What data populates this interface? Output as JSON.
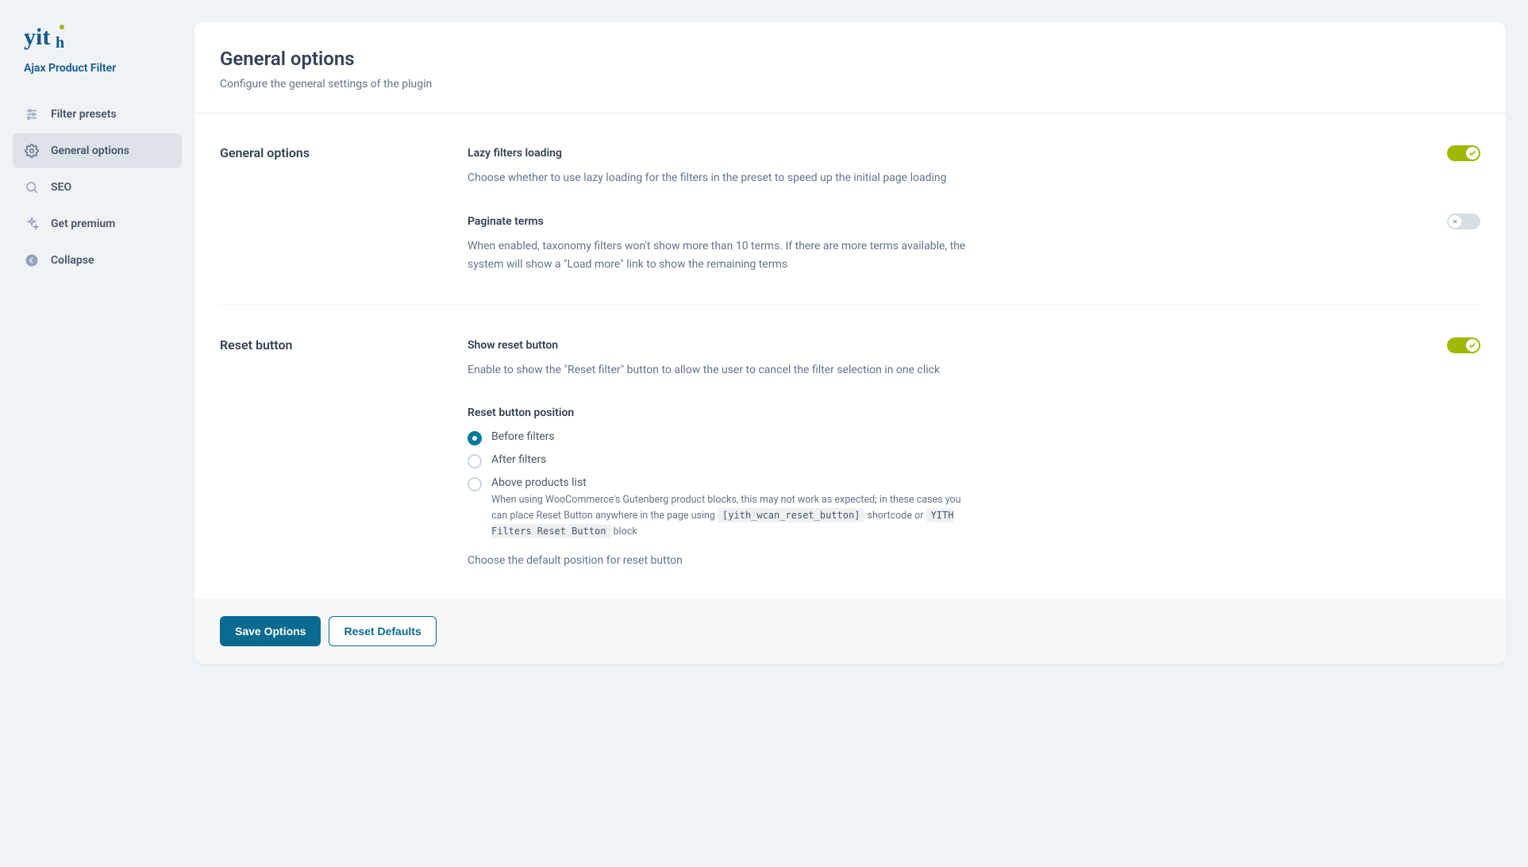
{
  "plugin_name": "Ajax Product Filter",
  "sidebar": {
    "items": [
      {
        "label": "Filter presets"
      },
      {
        "label": "General options"
      },
      {
        "label": "SEO"
      },
      {
        "label": "Get premium"
      },
      {
        "label": "Collapse"
      }
    ]
  },
  "header": {
    "title": "General options",
    "subtitle": "Configure the general settings of the plugin"
  },
  "sections": {
    "general": {
      "title": "General options",
      "lazy": {
        "label": "Lazy filters loading",
        "desc": "Choose whether to use lazy loading for the filters in the preset to speed up the initial page loading",
        "value": true
      },
      "paginate": {
        "label": "Paginate terms",
        "desc": "When enabled, taxonomy filters won't show more than 10 terms. If there are more terms available, the system will show a \"Load more\" link to show the remaining terms",
        "value": false
      }
    },
    "reset": {
      "title": "Reset button",
      "show": {
        "label": "Show reset button",
        "desc": "Enable to show the \"Reset filter\" button to allow the user to cancel the filter selection in one click",
        "value": true
      },
      "position": {
        "label": "Reset button position",
        "options": [
          {
            "label": "Before filters",
            "checked": true
          },
          {
            "label": "After filters",
            "checked": false
          },
          {
            "label": "Above products list",
            "checked": false
          }
        ],
        "hint_prefix": "When using WooCommerce's Gutenberg product blocks, this may not work as expected; in these cases you can place Reset Button anywhere in the page using ",
        "hint_code1": "[yith_wcan_reset_button]",
        "hint_middle": " shortcode or ",
        "hint_code2": "YITH Filters Reset Button",
        "hint_suffix": " block",
        "desc": "Choose the default position for reset button"
      }
    }
  },
  "footer": {
    "save": "Save Options",
    "reset": "Reset Defaults"
  }
}
